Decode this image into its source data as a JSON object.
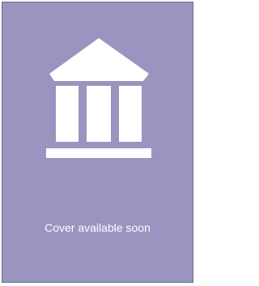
{
  "cover": {
    "caption": "Cover available soon",
    "icon": "institution-building-icon",
    "background_color": "#9a94c0",
    "icon_color": "#ffffff",
    "border_color": "#6e6a88"
  }
}
